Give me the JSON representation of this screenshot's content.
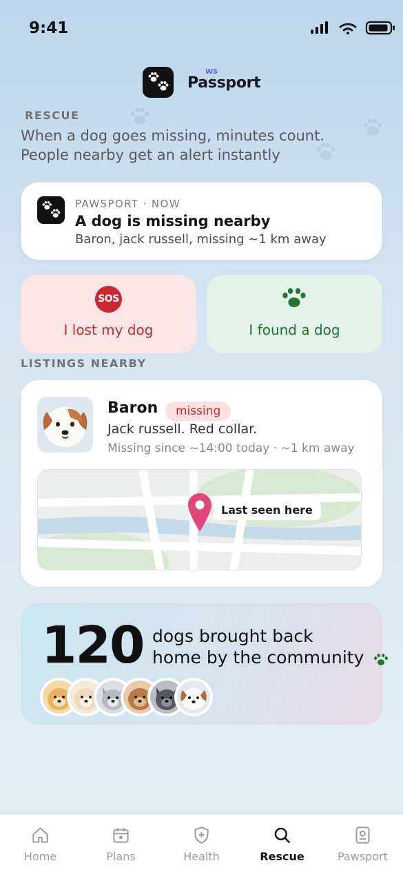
{
  "status_bar": {
    "time": "9:41"
  },
  "brand": {
    "name": "Passport",
    "superscript": "WS"
  },
  "section": {
    "label": "RESCUE"
  },
  "intro": {
    "line1": "When a dog goes missing, minutes count.",
    "line2": "People nearby get an alert instantly"
  },
  "notification": {
    "app": "PAWSPORT · NOW",
    "title": "A dog is missing nearby",
    "body": "Baron, jack russell, missing ~1 km away"
  },
  "actions": {
    "lost": {
      "badge": "SOS",
      "label": "I lost my dog"
    },
    "found": {
      "label": "I found a dog"
    }
  },
  "listings": {
    "label": "LISTINGS NEARBY",
    "items": [
      {
        "name": "Baron",
        "status": "missing",
        "description": "Jack russell. Red collar.",
        "meta": "Missing since ~14:00 today · ~1 km away",
        "map_label": "Last seen here"
      }
    ]
  },
  "stats": {
    "count": "120",
    "line1": "dogs brought back",
    "line2": "home by the community"
  },
  "tabs": [
    {
      "label": "Home",
      "icon": "home-icon"
    },
    {
      "label": "Plans",
      "icon": "calendar-icon"
    },
    {
      "label": "Health",
      "icon": "shield-plus-icon"
    },
    {
      "label": "Rescue",
      "icon": "search-icon",
      "active": true
    },
    {
      "label": "Pawsport",
      "icon": "id-badge-icon"
    }
  ],
  "colors": {
    "danger": "#c8282e",
    "success": "#237537",
    "pin": "#e0477a",
    "accent": "#6c5ce7"
  }
}
